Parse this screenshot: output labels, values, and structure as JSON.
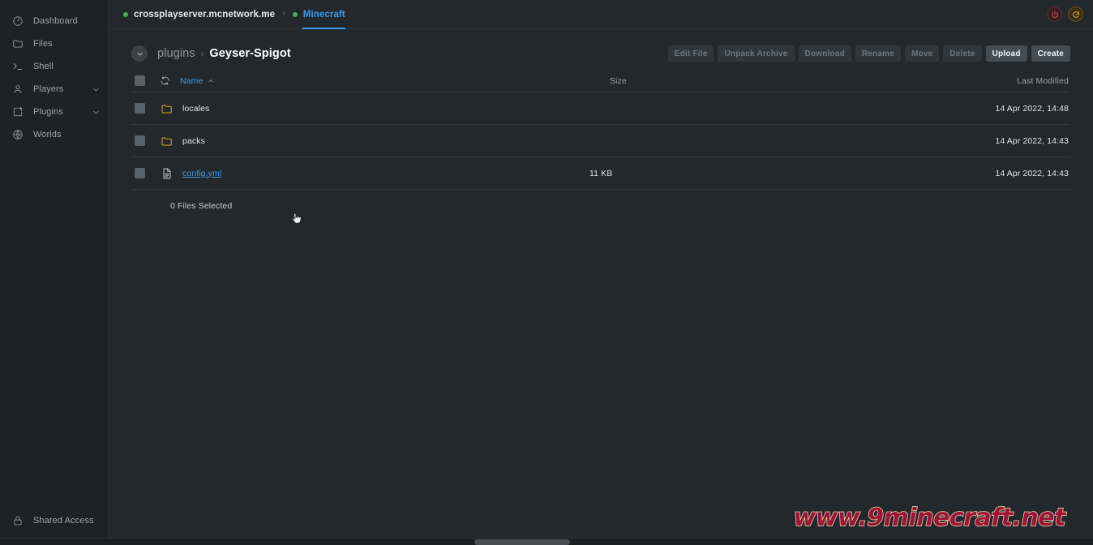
{
  "colors": {
    "accent": "#3d9ae8",
    "online": "#4caf50",
    "folder": "#b8902c",
    "bg": "#23282c",
    "sidebar_bg": "#1d2225",
    "power": "#d0565f",
    "restart": "#d6a23c",
    "watermark": "#9e1436",
    "watermark_outline": "#f2e3b4"
  },
  "sidebar": {
    "items": [
      {
        "label": "Dashboard",
        "icon": "gauge-icon",
        "expandable": false
      },
      {
        "label": "Files",
        "icon": "folder-icon",
        "expandable": false
      },
      {
        "label": "Shell",
        "icon": "terminal-icon",
        "expandable": false
      },
      {
        "label": "Players",
        "icon": "user-icon",
        "expandable": true
      },
      {
        "label": "Plugins",
        "icon": "plugin-icon",
        "expandable": true
      },
      {
        "label": "Worlds",
        "icon": "globe-icon",
        "expandable": false
      }
    ],
    "bottom": {
      "label": "Shared Access",
      "icon": "lock-icon"
    }
  },
  "topbar": {
    "breadcrumbs": [
      {
        "label": "crossplayserver.mcnetwork.me",
        "status": "online",
        "active": false
      },
      {
        "label": "Minecraft",
        "status": "online",
        "active": true
      }
    ],
    "separator": "›",
    "power_button": {
      "name": "power-button",
      "icon": "power-icon"
    },
    "restart_button": {
      "name": "restart-button",
      "icon": "restart-icon"
    }
  },
  "header": {
    "back_button_icon": "chevron-down-icon",
    "path": [
      {
        "label": "plugins",
        "current": false
      },
      {
        "label": "Geyser-Spigot",
        "current": true
      }
    ],
    "path_separator": "›",
    "actions": [
      {
        "label": "Edit File",
        "name": "edit-file-button",
        "enabled": false
      },
      {
        "label": "Unpack Archive",
        "name": "unpack-archive-button",
        "enabled": false
      },
      {
        "label": "Download",
        "name": "download-button",
        "enabled": false
      },
      {
        "label": "Rename",
        "name": "rename-button",
        "enabled": false
      },
      {
        "label": "Move",
        "name": "move-button",
        "enabled": false
      },
      {
        "label": "Delete",
        "name": "delete-button",
        "enabled": false
      },
      {
        "label": "Upload",
        "name": "upload-button",
        "enabled": true
      },
      {
        "label": "Create",
        "name": "create-button",
        "enabled": true
      }
    ]
  },
  "table": {
    "columns": {
      "name": "Name",
      "size": "Size",
      "modified": "Last Modified"
    },
    "sort": {
      "column": "Name",
      "direction": "asc",
      "caret": "caret-up-icon"
    },
    "refresh_icon": "refresh-icon",
    "rows": [
      {
        "name": "locales",
        "type": "folder",
        "icon": "folder-icon",
        "size": "",
        "modified": "14 Apr 2022, 14:48",
        "link": false
      },
      {
        "name": "packs",
        "type": "folder",
        "icon": "folder-icon",
        "size": "",
        "modified": "14 Apr 2022, 14:43",
        "link": false
      },
      {
        "name": "config.yml",
        "type": "file",
        "icon": "document-icon",
        "size": "11 KB",
        "modified": "14 Apr 2022, 14:43",
        "link": true
      }
    ],
    "footer": "0 Files Selected"
  },
  "watermark": {
    "text": "www.9minecraft.net"
  }
}
